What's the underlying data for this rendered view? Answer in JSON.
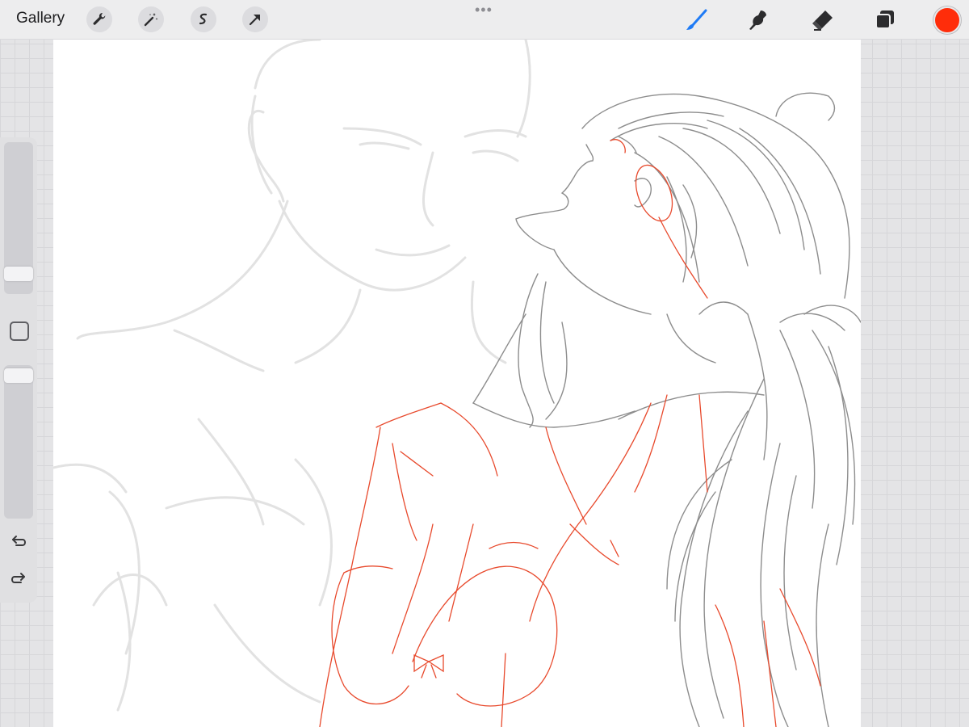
{
  "toolbar": {
    "gallery_label": "Gallery",
    "left_tools": [
      "wrench-icon",
      "magic-wand-icon",
      "selection-icon",
      "transform-arrow-icon"
    ],
    "more_indicator": "•••",
    "right_tools": [
      "brush-icon",
      "smudge-icon",
      "eraser-icon",
      "layers-icon"
    ],
    "active_tool": "brush",
    "active_tool_color": "#1f7bf5",
    "current_color": "#ff2d0a"
  },
  "sidebar": {
    "brush_size_level": 0.1,
    "opacity_level": 0.9,
    "buttons": [
      "modify-square-icon",
      "undo-icon",
      "redo-icon"
    ]
  },
  "canvas": {
    "background": "#ffffff",
    "sketch_colors": {
      "ink": "#8a8a8a",
      "ghost": "#e3e3e3",
      "red": "#e84a2d"
    }
  }
}
